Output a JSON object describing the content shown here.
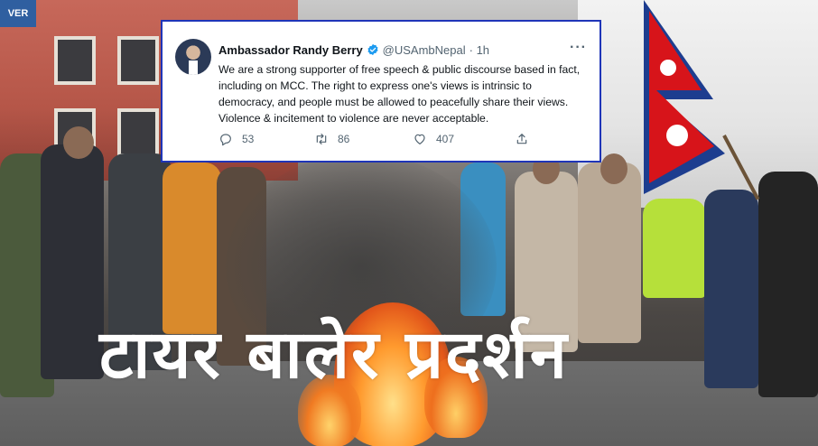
{
  "tweet": {
    "author_name": "Ambassador Randy Berry",
    "handle": "@USAmbNepal",
    "time": "· 1h",
    "text": "We are a strong supporter of free speech & public discourse based in fact, including on MCC. The right to express one's views is intrinsic to democracy, and people must be allowed to peacefully share their views. Violence & incitement to violence are never acceptable.",
    "actions": {
      "replies": "53",
      "retweets": "86",
      "likes": "407"
    },
    "icons": [
      "verified-badge-icon",
      "more-options-icon",
      "reply-icon",
      "retweet-icon",
      "like-icon",
      "share-icon"
    ],
    "colors": {
      "border": "#1f35b8",
      "verified": "#1d9bf0",
      "muted": "#536471"
    }
  },
  "headline": "टायर बालेर प्रदर्शन",
  "background": {
    "building_sign": "VER"
  }
}
